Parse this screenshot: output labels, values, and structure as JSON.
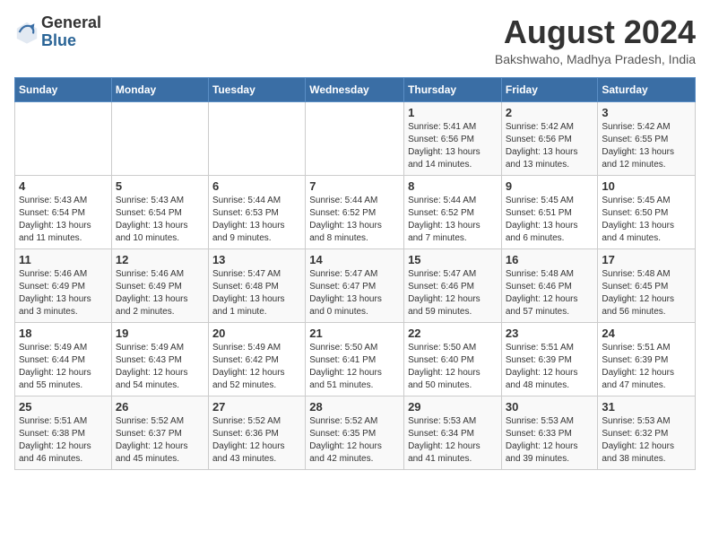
{
  "logo": {
    "line1": "General",
    "line2": "Blue"
  },
  "title": "August 2024",
  "subtitle": "Bakshwaho, Madhya Pradesh, India",
  "days_of_week": [
    "Sunday",
    "Monday",
    "Tuesday",
    "Wednesday",
    "Thursday",
    "Friday",
    "Saturday"
  ],
  "weeks": [
    [
      {
        "day": "",
        "detail": ""
      },
      {
        "day": "",
        "detail": ""
      },
      {
        "day": "",
        "detail": ""
      },
      {
        "day": "",
        "detail": ""
      },
      {
        "day": "1",
        "detail": "Sunrise: 5:41 AM\nSunset: 6:56 PM\nDaylight: 13 hours\nand 14 minutes."
      },
      {
        "day": "2",
        "detail": "Sunrise: 5:42 AM\nSunset: 6:56 PM\nDaylight: 13 hours\nand 13 minutes."
      },
      {
        "day": "3",
        "detail": "Sunrise: 5:42 AM\nSunset: 6:55 PM\nDaylight: 13 hours\nand 12 minutes."
      }
    ],
    [
      {
        "day": "4",
        "detail": "Sunrise: 5:43 AM\nSunset: 6:54 PM\nDaylight: 13 hours\nand 11 minutes."
      },
      {
        "day": "5",
        "detail": "Sunrise: 5:43 AM\nSunset: 6:54 PM\nDaylight: 13 hours\nand 10 minutes."
      },
      {
        "day": "6",
        "detail": "Sunrise: 5:44 AM\nSunset: 6:53 PM\nDaylight: 13 hours\nand 9 minutes."
      },
      {
        "day": "7",
        "detail": "Sunrise: 5:44 AM\nSunset: 6:52 PM\nDaylight: 13 hours\nand 8 minutes."
      },
      {
        "day": "8",
        "detail": "Sunrise: 5:44 AM\nSunset: 6:52 PM\nDaylight: 13 hours\nand 7 minutes."
      },
      {
        "day": "9",
        "detail": "Sunrise: 5:45 AM\nSunset: 6:51 PM\nDaylight: 13 hours\nand 6 minutes."
      },
      {
        "day": "10",
        "detail": "Sunrise: 5:45 AM\nSunset: 6:50 PM\nDaylight: 13 hours\nand 4 minutes."
      }
    ],
    [
      {
        "day": "11",
        "detail": "Sunrise: 5:46 AM\nSunset: 6:49 PM\nDaylight: 13 hours\nand 3 minutes."
      },
      {
        "day": "12",
        "detail": "Sunrise: 5:46 AM\nSunset: 6:49 PM\nDaylight: 13 hours\nand 2 minutes."
      },
      {
        "day": "13",
        "detail": "Sunrise: 5:47 AM\nSunset: 6:48 PM\nDaylight: 13 hours\nand 1 minute."
      },
      {
        "day": "14",
        "detail": "Sunrise: 5:47 AM\nSunset: 6:47 PM\nDaylight: 13 hours\nand 0 minutes."
      },
      {
        "day": "15",
        "detail": "Sunrise: 5:47 AM\nSunset: 6:46 PM\nDaylight: 12 hours\nand 59 minutes."
      },
      {
        "day": "16",
        "detail": "Sunrise: 5:48 AM\nSunset: 6:46 PM\nDaylight: 12 hours\nand 57 minutes."
      },
      {
        "day": "17",
        "detail": "Sunrise: 5:48 AM\nSunset: 6:45 PM\nDaylight: 12 hours\nand 56 minutes."
      }
    ],
    [
      {
        "day": "18",
        "detail": "Sunrise: 5:49 AM\nSunset: 6:44 PM\nDaylight: 12 hours\nand 55 minutes."
      },
      {
        "day": "19",
        "detail": "Sunrise: 5:49 AM\nSunset: 6:43 PM\nDaylight: 12 hours\nand 54 minutes."
      },
      {
        "day": "20",
        "detail": "Sunrise: 5:49 AM\nSunset: 6:42 PM\nDaylight: 12 hours\nand 52 minutes."
      },
      {
        "day": "21",
        "detail": "Sunrise: 5:50 AM\nSunset: 6:41 PM\nDaylight: 12 hours\nand 51 minutes."
      },
      {
        "day": "22",
        "detail": "Sunrise: 5:50 AM\nSunset: 6:40 PM\nDaylight: 12 hours\nand 50 minutes."
      },
      {
        "day": "23",
        "detail": "Sunrise: 5:51 AM\nSunset: 6:39 PM\nDaylight: 12 hours\nand 48 minutes."
      },
      {
        "day": "24",
        "detail": "Sunrise: 5:51 AM\nSunset: 6:39 PM\nDaylight: 12 hours\nand 47 minutes."
      }
    ],
    [
      {
        "day": "25",
        "detail": "Sunrise: 5:51 AM\nSunset: 6:38 PM\nDaylight: 12 hours\nand 46 minutes."
      },
      {
        "day": "26",
        "detail": "Sunrise: 5:52 AM\nSunset: 6:37 PM\nDaylight: 12 hours\nand 45 minutes."
      },
      {
        "day": "27",
        "detail": "Sunrise: 5:52 AM\nSunset: 6:36 PM\nDaylight: 12 hours\nand 43 minutes."
      },
      {
        "day": "28",
        "detail": "Sunrise: 5:52 AM\nSunset: 6:35 PM\nDaylight: 12 hours\nand 42 minutes."
      },
      {
        "day": "29",
        "detail": "Sunrise: 5:53 AM\nSunset: 6:34 PM\nDaylight: 12 hours\nand 41 minutes."
      },
      {
        "day": "30",
        "detail": "Sunrise: 5:53 AM\nSunset: 6:33 PM\nDaylight: 12 hours\nand 39 minutes."
      },
      {
        "day": "31",
        "detail": "Sunrise: 5:53 AM\nSunset: 6:32 PM\nDaylight: 12 hours\nand 38 minutes."
      }
    ]
  ]
}
